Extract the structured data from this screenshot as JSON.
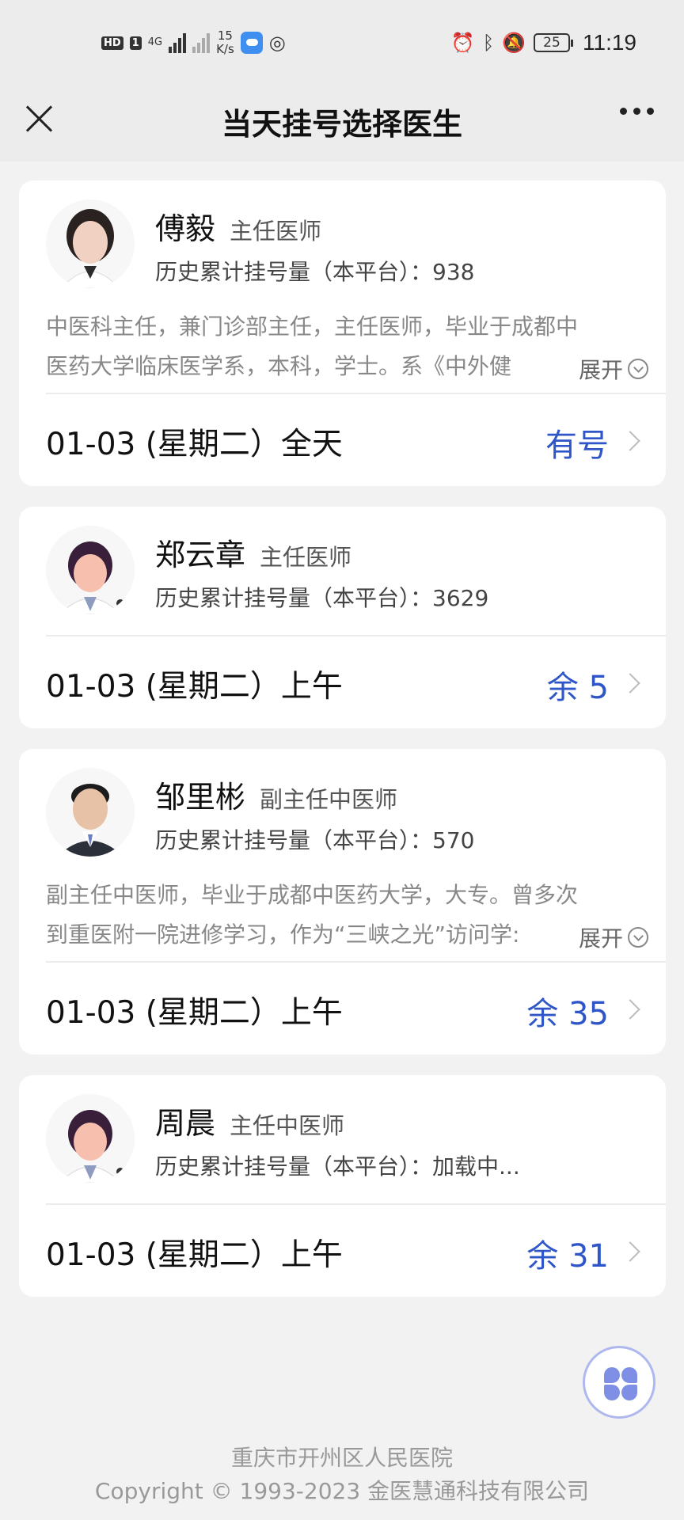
{
  "status_bar": {
    "hd_label": "HD",
    "sim_label": "1",
    "network_label": "4G",
    "speed_value": "15",
    "speed_unit": "K/s",
    "battery": "25",
    "time": "11:19"
  },
  "nav": {
    "title": "当天挂号选择医生"
  },
  "doctors": [
    {
      "name": "傅毅",
      "title": "主任医师",
      "count_label": "历史累计挂号量（本平台）：",
      "count": "938",
      "desc_line1": "中医科主任，兼门诊部主任，主任医师，毕业于成都中",
      "desc_line2": "医药大学临床医学系，本科，学士。系《中外健",
      "expand": "展开",
      "date": "01-03 (星期二）全天",
      "status": "有号",
      "avatar_icon": "female-doctor-photo"
    },
    {
      "name": "郑云章",
      "title": "主任医师",
      "count_label": "历史累计挂号量（本平台）：",
      "count": "3629",
      "date": "01-03 (星期二）上午",
      "status": "余 5",
      "avatar_icon": "default-doctor-avatar"
    },
    {
      "name": "邹里彬",
      "title": "副主任中医师",
      "count_label": "历史累计挂号量（本平台）：",
      "count": "570",
      "desc_line1": "副主任中医师，毕业于成都中医药大学，大专。曾多次",
      "desc_line2": "到重医附一院进修学习，作为“三峡之光”访问学:",
      "expand": "展开",
      "date": "01-03 (星期二）上午",
      "status": "余 35",
      "avatar_icon": "male-doctor-photo"
    },
    {
      "name": "周晨",
      "title": "主任中医师",
      "count_label": "历史累计挂号量（本平台）：",
      "count": "加载中...",
      "date": "01-03 (星期二）上午",
      "status": "余 31",
      "avatar_icon": "default-doctor-avatar"
    }
  ],
  "footer": {
    "hospital": "重庆市开州区人民医院",
    "copyright": "Copyright © 1993-2023 金医慧通科技有限公司"
  },
  "colors": {
    "accent": "#2f56c8",
    "page_bg": "#f2f2f2",
    "card_bg": "#ffffff"
  }
}
